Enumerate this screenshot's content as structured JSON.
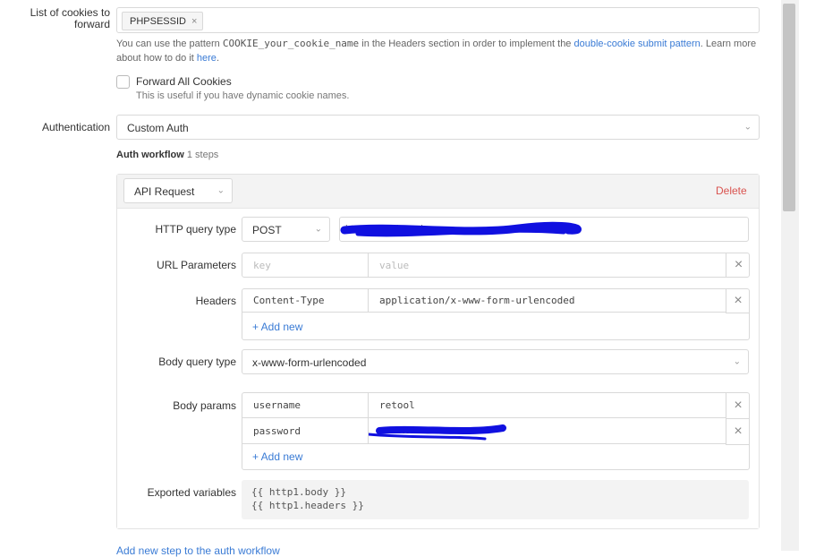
{
  "cookies": {
    "label": "List of cookies to forward",
    "tag": "PHPSESSID",
    "tag_remove": "×",
    "help_prefix": "You can use the pattern",
    "help_code": "COOKIE_your_cookie_name",
    "help_middle": "in the Headers section in order to implement the",
    "help_link": "double-cookie submit pattern",
    "help_suffix": ". Learn more about how to do it",
    "help_link2": "here",
    "help_end": "."
  },
  "forward_all": {
    "label": "Forward All Cookies",
    "help": "This is useful if you have dynamic cookie names."
  },
  "authentication": {
    "label": "Authentication",
    "value": "Custom Auth"
  },
  "workflow": {
    "title": "Auth workflow",
    "count": "1 steps",
    "step_type": "API Request",
    "delete": "Delete",
    "add_step": "Add new step to the auth workflow"
  },
  "http": {
    "label": "HTTP query type",
    "method": "POST",
    "url": "https://redacted"
  },
  "url_params": {
    "label": "URL Parameters",
    "key_placeholder": "key",
    "value_placeholder": "value"
  },
  "headers": {
    "label": "Headers",
    "rows": [
      {
        "key": "Content-Type",
        "value": "application/x-www-form-urlencoded"
      }
    ],
    "add_new": "+ Add new"
  },
  "body_type": {
    "label": "Body query type",
    "value": "x-www-form-urlencoded"
  },
  "body_params": {
    "label": "Body params",
    "rows": [
      {
        "key": "username",
        "value": "retool"
      },
      {
        "key": "password",
        "value": "redacted"
      }
    ],
    "add_new": "+ Add new"
  },
  "exported": {
    "label": "Exported variables",
    "lines": [
      "{{ http1.body }}",
      "{{ http1.headers }}"
    ]
  },
  "colors": {
    "link": "#3a7bd5",
    "delete": "#d9534f",
    "redaction": "#1010e0"
  }
}
